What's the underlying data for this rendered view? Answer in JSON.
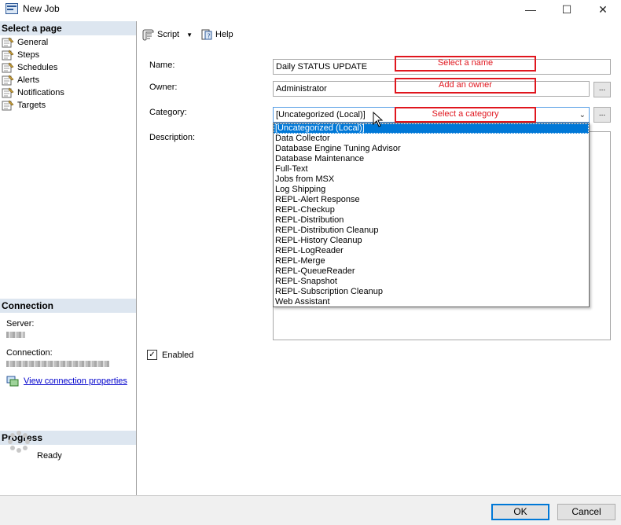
{
  "window": {
    "title": "New Job",
    "minimize_glyph": "—",
    "maximize_glyph": "☐",
    "close_glyph": "✕"
  },
  "left_pane": {
    "select_page_header": "Select a page",
    "pages": [
      {
        "label": "General",
        "icon": "wrench-page-icon"
      },
      {
        "label": "Steps",
        "icon": "wrench-page-icon"
      },
      {
        "label": "Schedules",
        "icon": "wrench-page-icon"
      },
      {
        "label": "Alerts",
        "icon": "wrench-page-icon"
      },
      {
        "label": "Notifications",
        "icon": "wrench-page-icon"
      },
      {
        "label": "Targets",
        "icon": "wrench-page-icon"
      }
    ],
    "connection_header": "Connection",
    "server_label": "Server:",
    "connection_label": "Connection:",
    "view_connection_link": "View connection properties",
    "progress_header": "Progress",
    "progress_status": "Ready"
  },
  "toolbar": {
    "script_label": "Script",
    "help_label": "Help"
  },
  "form": {
    "name_label": "Name:",
    "name_value": "Daily STATUS UPDATE",
    "owner_label": "Owner:",
    "owner_value": "Administrator",
    "category_label": "Category:",
    "category_value": "[Uncategorized (Local)]",
    "description_label": "Description:",
    "browse_label": "...",
    "enabled_label": "Enabled",
    "enabled_checked": true,
    "category_options": [
      "[Uncategorized (Local)]",
      "Data Collector",
      "Database Engine Tuning Advisor",
      "Database Maintenance",
      "Full-Text",
      "Jobs from MSX",
      "Log Shipping",
      "REPL-Alert Response",
      "REPL-Checkup",
      "REPL-Distribution",
      "REPL-Distribution Cleanup",
      "REPL-History Cleanup",
      "REPL-LogReader",
      "REPL-Merge",
      "REPL-QueueReader",
      "REPL-Snapshot",
      "REPL-Subscription Cleanup",
      "Web Assistant"
    ]
  },
  "annotations": {
    "name": "Select a name",
    "owner": "Add an owner",
    "category": "Select a category"
  },
  "buttons": {
    "ok": "OK",
    "cancel": "Cancel"
  },
  "colors": {
    "accent": "#0078d7",
    "annotation": "#e0161e",
    "pane_header": "#dde6f0"
  }
}
